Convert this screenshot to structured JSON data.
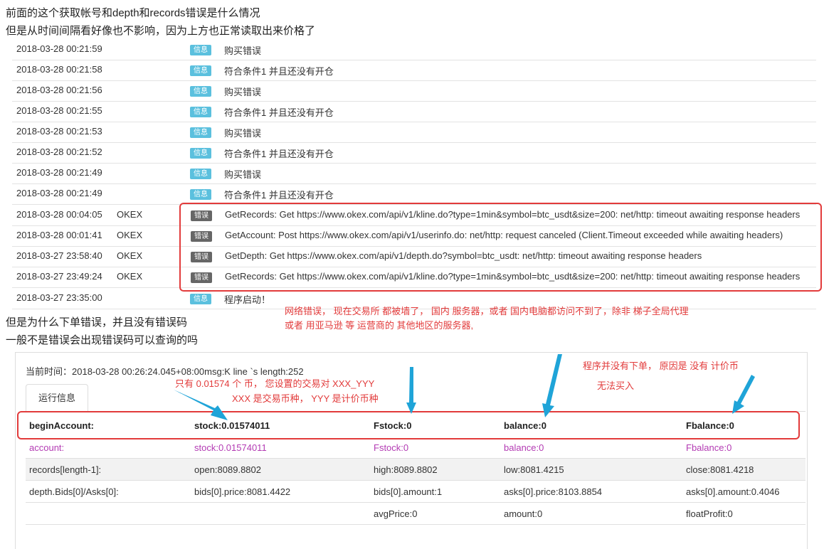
{
  "questions": {
    "q1": "前面的这个获取帐号和depth和records错误是什么情况",
    "q2": "但是从时间间隔看好像也不影响，因为上方也正常读取出来价格了",
    "q3": "但是为什么下单错误，并且没有错误码",
    "q4": "一般不是错误会出现错误码可以查询的吗"
  },
  "badges": {
    "info": "信息",
    "error": "错误"
  },
  "logs": [
    {
      "time": "2018-03-28 00:21:59",
      "exchange": "",
      "level": "info",
      "msg": "购买错误"
    },
    {
      "time": "2018-03-28 00:21:58",
      "exchange": "",
      "level": "info",
      "msg": "符合条件1 并且还没有开仓"
    },
    {
      "time": "2018-03-28 00:21:56",
      "exchange": "",
      "level": "info",
      "msg": "购买错误"
    },
    {
      "time": "2018-03-28 00:21:55",
      "exchange": "",
      "level": "info",
      "msg": "符合条件1 并且还没有开仓"
    },
    {
      "time": "2018-03-28 00:21:53",
      "exchange": "",
      "level": "info",
      "msg": "购买错误"
    },
    {
      "time": "2018-03-28 00:21:52",
      "exchange": "",
      "level": "info",
      "msg": "符合条件1 并且还没有开仓"
    },
    {
      "time": "2018-03-28 00:21:49",
      "exchange": "",
      "level": "info",
      "msg": "购买错误"
    },
    {
      "time": "2018-03-28 00:21:49",
      "exchange": "",
      "level": "info",
      "msg": "符合条件1 并且还没有开仓"
    },
    {
      "time": "2018-03-28 00:04:05",
      "exchange": "OKEX",
      "level": "error",
      "msg": "GetRecords: Get https://www.okex.com/api/v1/kline.do?type=1min&symbol=btc_usdt&size=200: net/http: timeout awaiting response headers"
    },
    {
      "time": "2018-03-28 00:01:41",
      "exchange": "OKEX",
      "level": "error",
      "msg": "GetAccount: Post https://www.okex.com/api/v1/userinfo.do: net/http: request canceled (Client.Timeout exceeded while awaiting headers)"
    },
    {
      "time": "2018-03-27 23:58:40",
      "exchange": "OKEX",
      "level": "error",
      "msg": "GetDepth: Get https://www.okex.com/api/v1/depth.do?symbol=btc_usdt: net/http: timeout awaiting response headers"
    },
    {
      "time": "2018-03-27 23:49:24",
      "exchange": "OKEX",
      "level": "error",
      "msg": "GetRecords: Get https://www.okex.com/api/v1/kline.do?type=1min&symbol=btc_usdt&size=200: net/http: timeout awaiting response headers"
    },
    {
      "time": "2018-03-27 23:35:00",
      "exchange": "",
      "level": "info",
      "msg": "程序启动！"
    }
  ],
  "annotations": {
    "net1": "网络错误，  现在交易所 都被墙了，   国内 服务器，或者 国内电脑都访问不到了，除非  梯子全局代理",
    "net2": "或者 用亚马逊 等 运营商的 其他地区的服务器,",
    "coin1": "只有 0.01574 个 币，  您设置的交易对  XXX_YYY",
    "coin2": "XXX 是交易币种，  YYY 是计价币种",
    "buy1": "程序并没有下单，  原因是 没有  计价币",
    "buy2": "无法买入"
  },
  "status": {
    "current_time": "当前时间：2018-03-28 00:26:24.045+08:00msg:K line `s length:252",
    "tab": "运行信息"
  },
  "table": [
    [
      "beginAccount:",
      "stock:0.01574011",
      "Fstock:0",
      "balance:0",
      "Fbalance:0"
    ],
    [
      "account:",
      "stock:0.01574011",
      "Fstock:0",
      "balance:0",
      "Fbalance:0"
    ],
    [
      "records[length-1]:",
      "open:8089.8802",
      "high:8089.8802",
      "low:8081.4215",
      "close:8081.4218"
    ],
    [
      "depth.Bids[0]/Asks[0]:",
      "bids[0].price:8081.4422",
      "bids[0].amount:1",
      "asks[0].price:8103.8854",
      "asks[0].amount:0.4046"
    ],
    [
      "",
      "",
      "avgPrice:0",
      "amount:0",
      "floatProfit:0"
    ]
  ],
  "colors": {
    "accent_red": "#e23b3b",
    "arrow_blue": "#1fa4d8",
    "account_purple": "#b33bb3",
    "info_badge": "#5bc0de",
    "error_badge": "#666666"
  }
}
